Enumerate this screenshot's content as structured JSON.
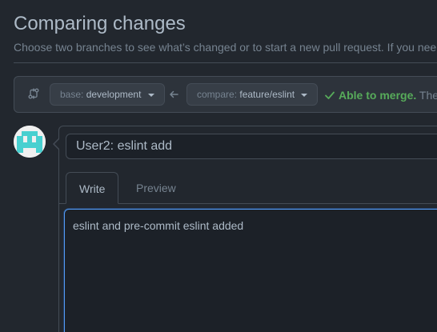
{
  "header": {
    "title": "Comparing changes",
    "subtitle": "Choose two branches to see what’s changed or to start a new pull request. If you nee"
  },
  "range": {
    "base_label": "base:",
    "base_value": "development",
    "compare_label": "compare:",
    "compare_value": "feature/eslint",
    "merge_ok": "Able to merge.",
    "merge_rest": "The"
  },
  "form": {
    "title_value": "User2: eslint add",
    "tabs": [
      "Write",
      "Preview"
    ],
    "body_value": "eslint and pre-commit eslint added"
  },
  "icons": {
    "range": "git-compare-icon",
    "arrow": "arrow-left-icon",
    "check": "check-icon",
    "avatar": "identicon-avatar"
  },
  "colors": {
    "accent": "#539bf5",
    "success": "#57ab5a",
    "background": "#22272e",
    "avatar_fg": "#48d0d0"
  }
}
